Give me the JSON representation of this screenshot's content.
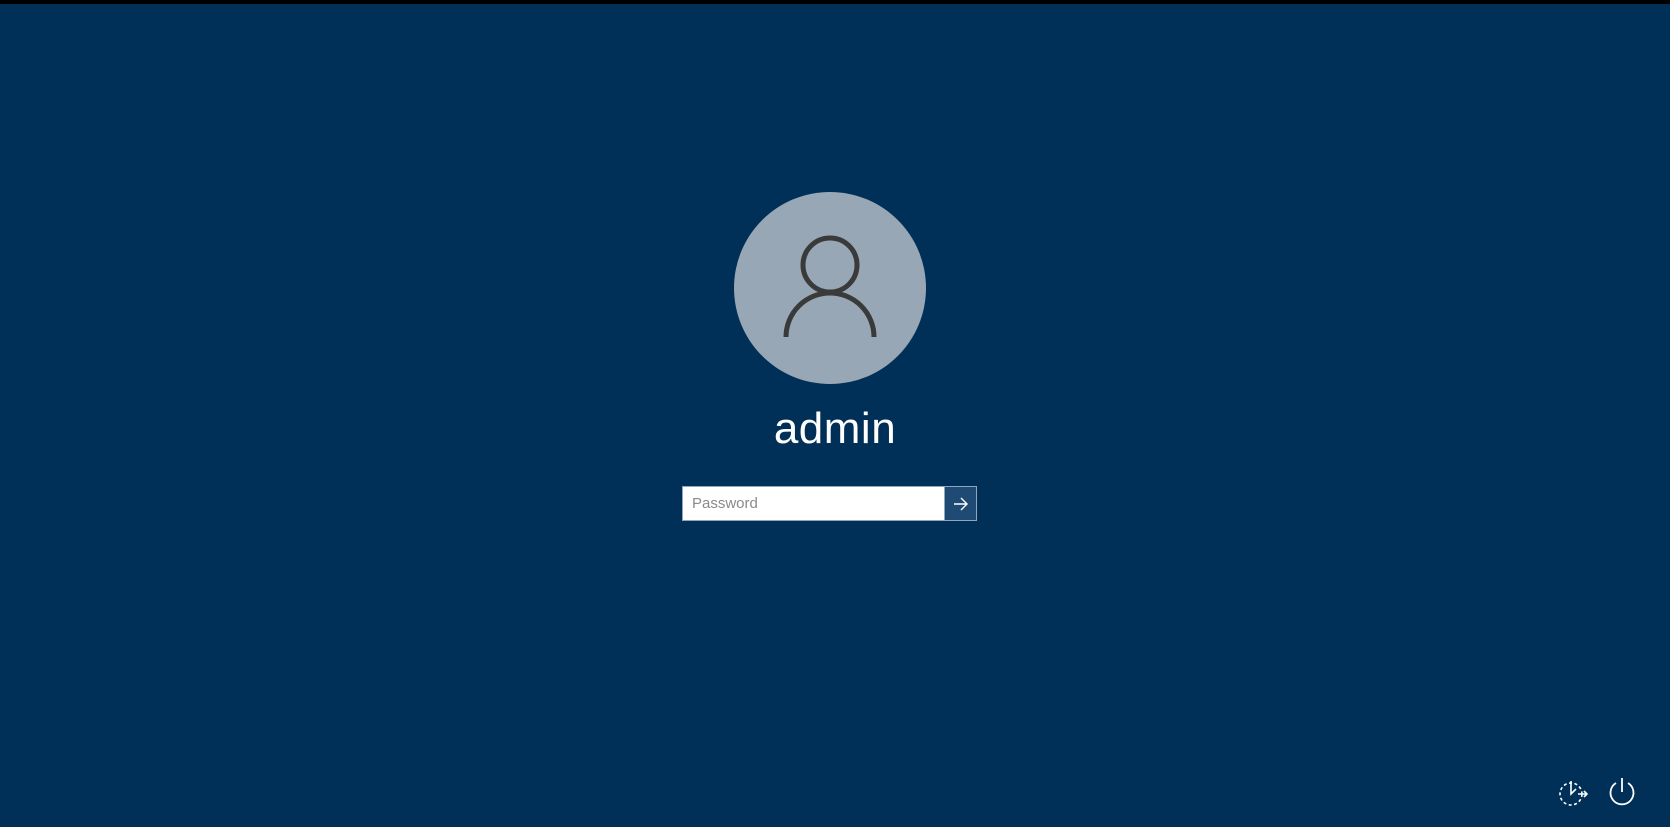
{
  "user": {
    "name": "admin"
  },
  "password_field": {
    "placeholder": "Password",
    "value": ""
  },
  "submit_button": {
    "icon": "arrow-right-icon"
  },
  "bottom_right": {
    "ease_of_access_icon": "ease-of-access-icon",
    "power_icon": "power-icon"
  },
  "colors": {
    "background": "#003057",
    "avatar": "#98a7b6",
    "submit_button": "#1f4a73"
  }
}
